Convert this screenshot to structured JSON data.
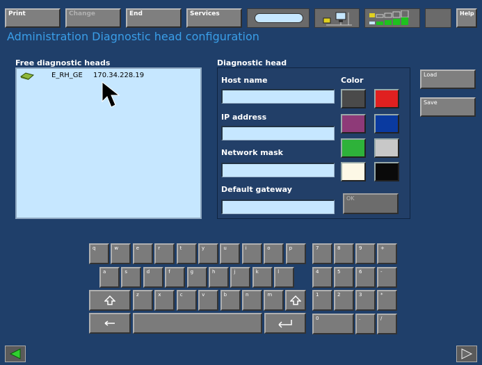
{
  "toolbar": {
    "print": "Print",
    "change": "Change",
    "end": "End",
    "services": "Services",
    "help": "Help"
  },
  "header": {
    "title": "Administration  Diagnostic head configuration"
  },
  "free_heads": {
    "label": "Free diagnostic heads",
    "items": [
      {
        "name": "E_RH_GE",
        "ip": "170.34.228.19"
      }
    ]
  },
  "diag_head": {
    "label": "Diagnostic head",
    "host_name_label": "Host name",
    "ip_label": "IP address",
    "mask_label": "Network mask",
    "gateway_label": "Default gateway",
    "color_label": "Color",
    "host_name": "",
    "ip": "",
    "mask": "",
    "gateway": "",
    "ok": "OK",
    "colors": [
      "#4a4a4a",
      "#e02020",
      "#8e3a78",
      "#0a3aa0",
      "#2eb23a",
      "#c8c8c8",
      "#fdf8e6",
      "#0a0a0a"
    ]
  },
  "side": {
    "load": "Load",
    "save": "Save"
  },
  "keyboard": {
    "row1": [
      "q",
      "w",
      "e",
      "r",
      "t",
      "y",
      "u",
      "i",
      "o",
      "p"
    ],
    "row2": [
      "a",
      "s",
      "d",
      "f",
      "g",
      "h",
      "j",
      "k",
      "l"
    ],
    "row3": [
      "z",
      "x",
      "c",
      "v",
      "b",
      "n",
      "m"
    ],
    "numpad": [
      "7",
      "8",
      "9",
      "+",
      "4",
      "5",
      "6",
      "-",
      "1",
      "2",
      "3",
      "*",
      "0",
      "",
      ".",
      "/"
    ]
  }
}
